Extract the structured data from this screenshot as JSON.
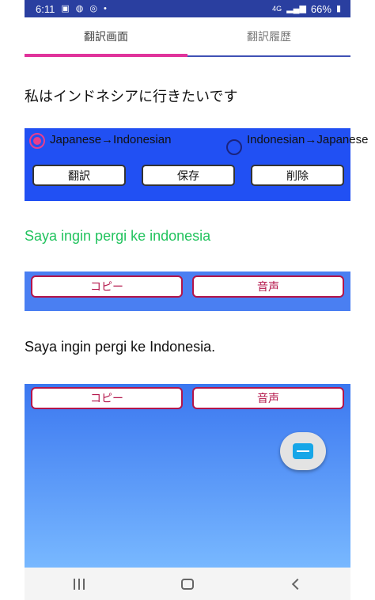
{
  "status": {
    "time": "6:11",
    "network": "4G",
    "battery": "66%"
  },
  "tabs": [
    {
      "label": "翻訳画面"
    },
    {
      "label": "翻訳履歴"
    }
  ],
  "source_text": "私はインドネシアに行きたいです",
  "direction": {
    "option1": "Japanese→Indonesian",
    "option2": "Indonesian→Japanese",
    "selected": "option1"
  },
  "actions": {
    "translate": "翻訳",
    "save": "保存",
    "delete": "削除"
  },
  "result_text": "Saya ingin pergi ke indonesia",
  "result_actions": {
    "copy": "コピー",
    "speak": "音声"
  },
  "second_text": "Saya ingin pergi ke Indonesia.",
  "second_actions": {
    "copy": "コピー",
    "speak": "音声"
  },
  "colors": {
    "accent": "#e0339b",
    "panel": "#2150f3",
    "result": "#22c35e",
    "pill_border": "#b3154a"
  }
}
